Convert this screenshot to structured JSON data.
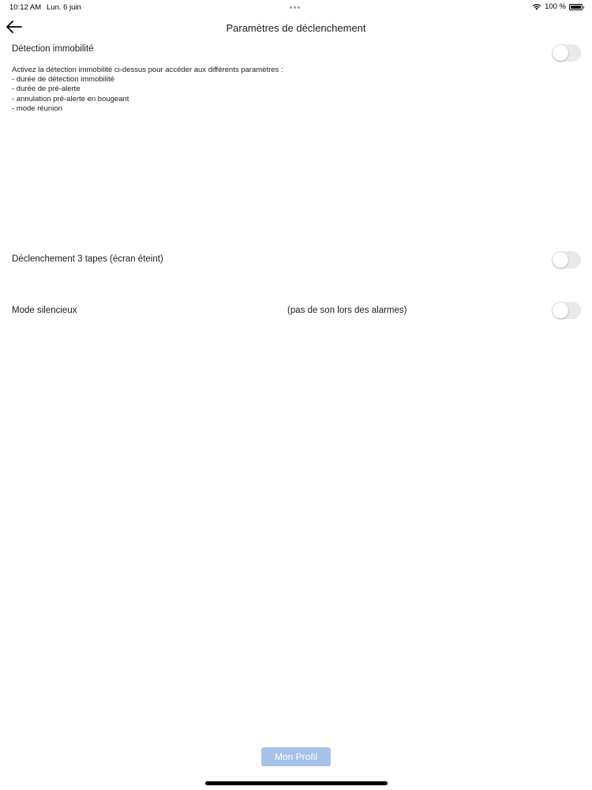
{
  "status_bar": {
    "time": "10:12 AM",
    "date": "Lun. 6 juin",
    "battery": "100 %"
  },
  "nav": {
    "title": "Paramètres de déclenchement"
  },
  "immobility": {
    "label": "Détection immobilité",
    "enabled": false,
    "description": [
      "Activez la détection immobilité ci-dessus pour accéder aux différents paramètres :",
      "- durée de détection immobilité",
      "- durée de pré-alerte",
      "- annulation pré-alerte en bougeant",
      "- mode réunion"
    ]
  },
  "triple_tap": {
    "label": "Déclenchement 3 tapes (écran éteint)",
    "enabled": false
  },
  "silent_mode": {
    "label": "Mode silencieux",
    "note": "(pas de son lors des alarmes)",
    "enabled": false
  },
  "footer": {
    "profile_button": "Mon Profil"
  },
  "colors": {
    "toggle_off": "#e9e9eb",
    "button_disabled": "#a7c1e9"
  }
}
